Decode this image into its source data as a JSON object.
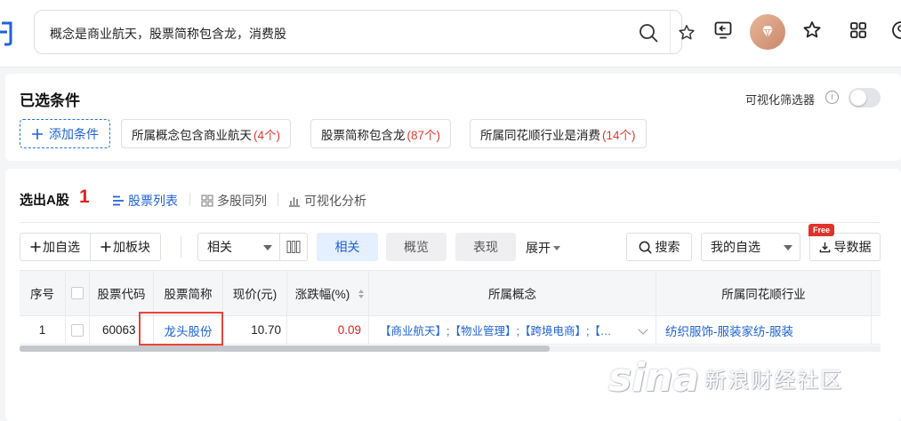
{
  "header": {
    "search_query": "概念是商业航天，股票简称包含龙，消费股"
  },
  "conditions": {
    "title": "已选条件",
    "visual_filter_label": "可视化筛选器",
    "info_glyph": "i",
    "add_label": "添加条件",
    "chips": [
      {
        "label": "所属概念包含商业航天",
        "count": "(4个)"
      },
      {
        "label": "股票简称包含龙",
        "count": "(87个)"
      },
      {
        "label": "所属同花顺行业是消费",
        "count": "(14个)"
      }
    ]
  },
  "results": {
    "title": "选出A股",
    "count": "1",
    "tabs": [
      {
        "label": "股票列表"
      },
      {
        "label": "多股同列"
      },
      {
        "label": "可视化分析"
      }
    ]
  },
  "toolbar": {
    "add_watch": "加自选",
    "add_block": "加板块",
    "sort_select": "相关",
    "pill_related": "相关",
    "pill_overview": "概览",
    "pill_performance": "表现",
    "expand": "展开",
    "search": "搜索",
    "my_watch": "我的自选",
    "free_badge": "Free",
    "export": "导数据"
  },
  "table": {
    "headers": [
      "序号",
      "股票代码",
      "股票简称",
      "现价(元)",
      "涨跌幅(%)",
      "所属概念",
      "所属同花顺行业"
    ],
    "rows": [
      {
        "index": "1",
        "code": "60063",
        "name": "龙头股份",
        "price": "10.70",
        "change": "0.09",
        "concepts": "【商业航天】;【物业管理】;【跨境电商】;【…",
        "industry": "纺织服饰-服装家纺-服装"
      }
    ]
  },
  "colors": {
    "accent": "#1e63d6",
    "rise": "#e02020",
    "highlight_box": "#e8453b"
  }
}
